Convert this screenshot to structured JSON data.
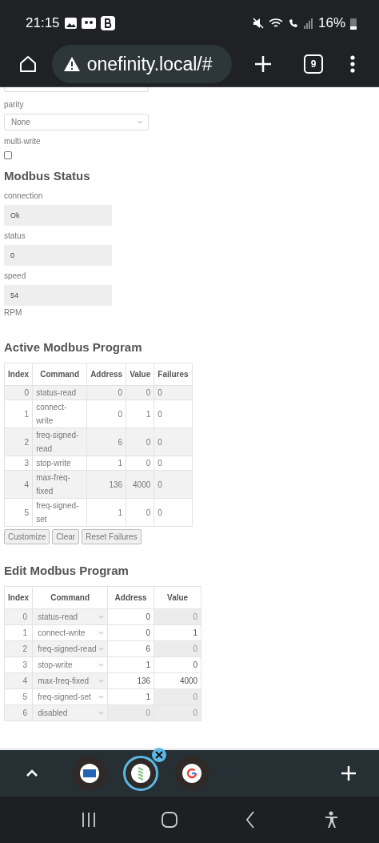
{
  "status_bar": {
    "time": "21:15",
    "battery": "16%"
  },
  "browser": {
    "url": "onefinity.local/#",
    "tab_count": "9"
  },
  "settings": {
    "fields": [
      {
        "kind": "select",
        "label": "parity",
        "value": "None"
      },
      {
        "kind": "checkbox",
        "label": "multi-write",
        "checked": false
      }
    ]
  },
  "modbus_status": {
    "title": "Modbus Status",
    "fields": [
      {
        "label": "connection",
        "value": "Ok"
      },
      {
        "label": "status",
        "value": "0"
      },
      {
        "label": "speed",
        "value": "54"
      }
    ],
    "unit": "RPM"
  },
  "active_program": {
    "title": "Active Modbus Program",
    "columns": [
      "Index",
      "Command",
      "Address",
      "Value",
      "Failures"
    ],
    "rows": [
      [
        "0",
        "status-read",
        "0",
        "0",
        "0"
      ],
      [
        "1",
        "connect-write",
        "0",
        "1",
        "0"
      ],
      [
        "2",
        "freq-signed-read",
        "6",
        "0",
        "0"
      ],
      [
        "3",
        "stop-write",
        "1",
        "0",
        "0"
      ],
      [
        "4",
        "max-freq-fixed",
        "136",
        "4000",
        "0"
      ],
      [
        "5",
        "freq-signed-set",
        "1",
        "0",
        "0"
      ]
    ],
    "buttons": [
      "Customize",
      "Clear",
      "Reset Failures"
    ]
  },
  "edit_program": {
    "title": "Edit Modbus Program",
    "columns": [
      "Index",
      "Command",
      "Address",
      "Value"
    ],
    "rows": [
      {
        "index": "0",
        "command": "status-read",
        "address": {
          "value": "0",
          "disabled": false
        },
        "value": {
          "value": "0",
          "disabled": true
        }
      },
      {
        "index": "1",
        "command": "connect-write",
        "address": {
          "value": "0",
          "disabled": false
        },
        "value": {
          "value": "1",
          "disabled": false
        }
      },
      {
        "index": "2",
        "command": "freq-signed-read",
        "address": {
          "value": "6",
          "disabled": false
        },
        "value": {
          "value": "0",
          "disabled": true
        }
      },
      {
        "index": "3",
        "command": "stop-write",
        "address": {
          "value": "1",
          "disabled": false
        },
        "value": {
          "value": "0",
          "disabled": false
        }
      },
      {
        "index": "4",
        "command": "max-freq-fixed",
        "address": {
          "value": "136",
          "disabled": false
        },
        "value": {
          "value": "4000",
          "disabled": false
        }
      },
      {
        "index": "5",
        "command": "freq-signed-set",
        "address": {
          "value": "1",
          "disabled": false
        },
        "value": {
          "value": "0",
          "disabled": true
        }
      },
      {
        "index": "6",
        "command": "disabled",
        "address": {
          "value": "0",
          "disabled": true
        },
        "value": {
          "value": "0",
          "disabled": true
        }
      }
    ]
  },
  "tab_group": {
    "tabs": [
      {
        "kind": "nhs",
        "selected": false
      },
      {
        "kind": "app",
        "selected": true
      },
      {
        "kind": "google",
        "selected": false
      }
    ]
  }
}
